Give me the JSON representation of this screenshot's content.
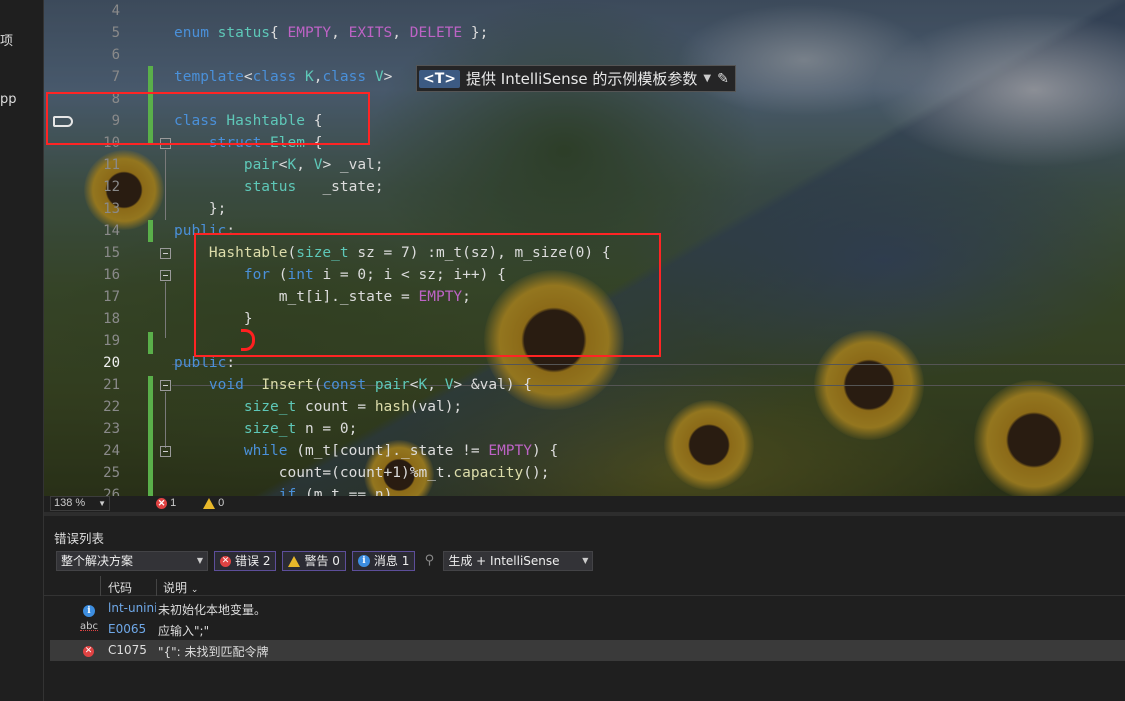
{
  "left_strip": {
    "fragment_1": "项",
    "fragment_2": "pp"
  },
  "editor": {
    "line_numbers": [
      "4",
      "5",
      "6",
      "7",
      "8",
      "9",
      "10",
      "11",
      "12",
      "13",
      "14",
      "15",
      "16",
      "17",
      "18",
      "19",
      "20",
      "21",
      "22",
      "23",
      "24",
      "25",
      "26"
    ],
    "current_line": "20"
  },
  "hint": {
    "tag": "<T>",
    "text": "提供 IntelliSense 的示例模板参数"
  },
  "editor_status": {
    "zoom": "138 %",
    "errors": "1",
    "warnings": "0"
  },
  "error_list": {
    "title": "错误列表",
    "scope": "整个解决方案",
    "errors_chip": "错误 2",
    "warnings_chip": "警告 0",
    "messages_chip": "消息 1",
    "build_filter": "生成 + IntelliSense",
    "col_code": "代码",
    "col_desc": "说明",
    "rows": [
      {
        "code": "lnt-uninit",
        "desc": "未初始化本地变量。"
      },
      {
        "code": "E0065",
        "desc": "应输入\";\""
      },
      {
        "code": "C1075",
        "desc": "\"{\": 未找到匹配令牌"
      }
    ]
  },
  "colors": {
    "change_bar": "#5aaf4a",
    "annotation_red": "#ff2424",
    "keyword": "#4a90d9",
    "type": "#5ec8b8"
  }
}
